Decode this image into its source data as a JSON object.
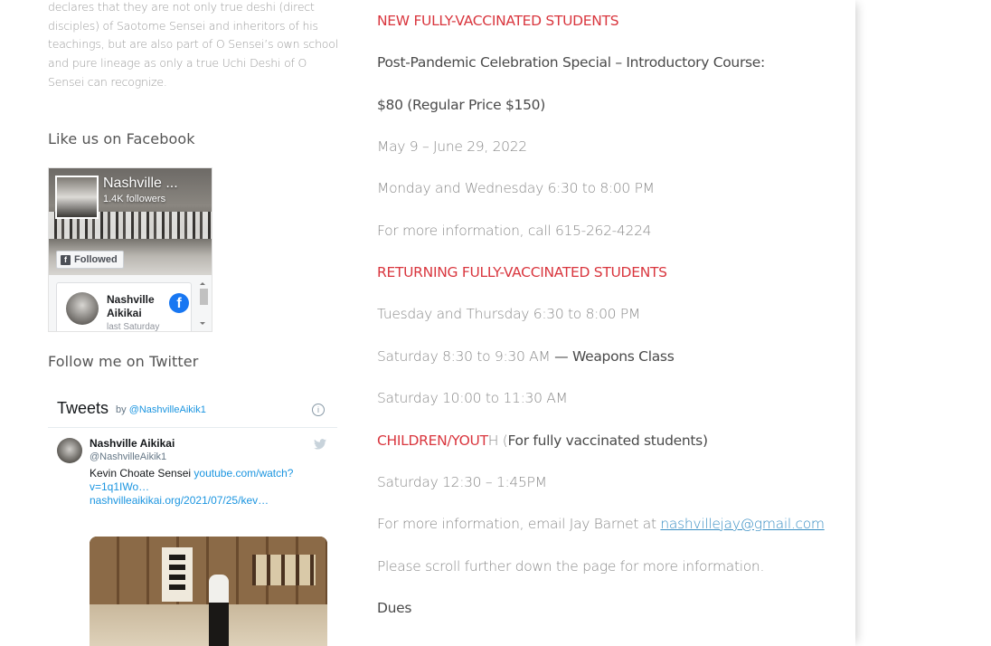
{
  "sidebar": {
    "intro_text": "declares that they are not only true deshi (direct disciples) of Saotome Sensei and inheritors of his teachings, but are also part of O Sensei’s own school and pure lineage as only a true Uchi Deshi of O Sensei can recognize.",
    "facebook_title": "Like us on Facebook",
    "facebook": {
      "page_name": "Nashville ...",
      "followers": "1.4K followers",
      "followed_label": "Followed",
      "post_author": "Nashville Aikikai",
      "post_time": "last Saturday"
    },
    "twitter_title": "Follow me on Twitter",
    "twitter": {
      "header": "Tweets",
      "by_prefix": "by",
      "by_handle": "@NashvilleAikik1",
      "tweet_name": "Nashville Aikikai",
      "tweet_handle": "@NashvilleAikik1",
      "tweet_text_prefix": "Kevin Choate Sensei",
      "tweet_link_1": "youtube.com/watch?v=1q1IWo…",
      "tweet_link_2": "nashvilleaikikai.org/2021/07/25/kev…"
    }
  },
  "main": {
    "new_students_heading": "NEW FULLY-VACCINATED STUDENTS",
    "special": "Post-Pandemic Celebration Special – Introductory Course:",
    "price": "$80 (Regular Price $150)",
    "dates": "May 9 – June 29, 2022",
    "schedule_new": "Monday and Wednesday 6:30 to 8:00 PM",
    "call_info": "For more information, call 615-262-4224",
    "returning_heading": "RETURNING FULLY-VACCINATED STUDENTS",
    "returning_weekday": "Tuesday and Thursday 6:30 to 8:00 PM",
    "saturday_weapons_time": "Saturday 8:30 to 9:30 AM",
    "saturday_weapons_dash": " — ",
    "saturday_weapons_label": "Weapons Class",
    "saturday_late": "Saturday 10:00 to 11:30 AM",
    "children_heading_red": "CHILDREN/YOUT",
    "children_heading_tail": "H (",
    "children_note": "For fully vaccinated students)",
    "children_time": "Saturday 12:30 – 1:45PM",
    "email_prefix": "For more information, email Jay Barnet at ",
    "email": "nashvillejay@gmail.com",
    "scroll_note": "Please scroll further down the page for more information.",
    "dues": "Dues"
  },
  "colors": {
    "heading_red": "#d9363e",
    "link_blue": "#3a8fc4",
    "facebook_blue": "#1877f2",
    "twitter_blue": "#1b95e0"
  }
}
